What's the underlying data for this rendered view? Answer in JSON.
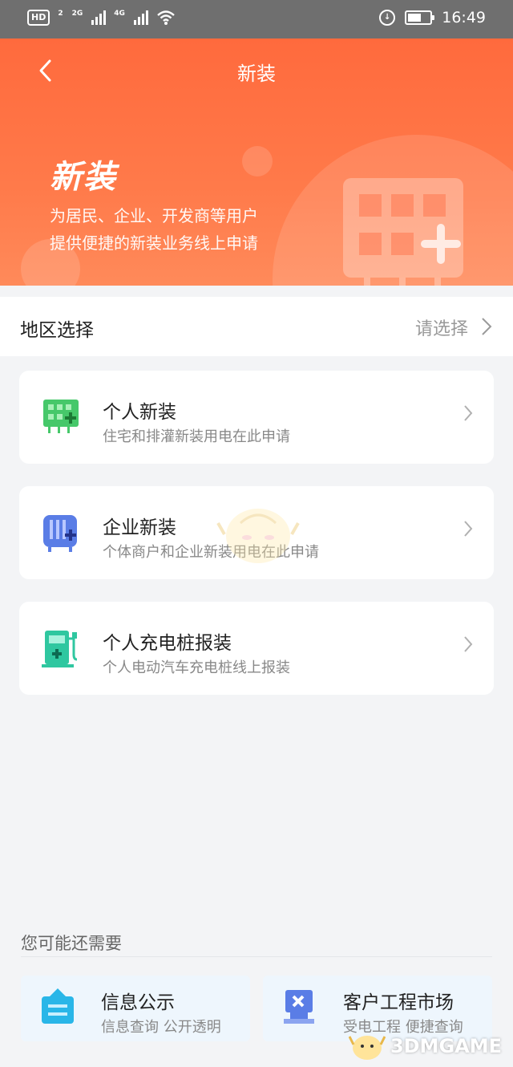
{
  "status_bar": {
    "hd_label": "HD",
    "sim_index": "2",
    "net_2g": "2G",
    "net_4g": "4G",
    "time": "16:49",
    "battery_percent": 60
  },
  "header": {
    "title": "新装"
  },
  "hero": {
    "heading": "新装",
    "desc_line1": "为居民、企业、开发商等用户",
    "desc_line2": "提供便捷的新装业务线上申请"
  },
  "region": {
    "label": "地区选择",
    "value": "请选择"
  },
  "services": [
    {
      "title": "个人新装",
      "subtitle": "住宅和排灌新装用电在此申请",
      "icon": "meter-icon"
    },
    {
      "title": "企业新装",
      "subtitle": "个体商户和企业新装用电在此申请",
      "icon": "building-icon"
    },
    {
      "title": "个人充电桩报装",
      "subtitle": "个人电动汽车充电桩线上报装",
      "icon": "charging-pile-icon"
    }
  ],
  "recommend": {
    "section_title": "您可能还需要",
    "items": [
      {
        "title": "信息公示",
        "subtitle": "信息查询 公开透明",
        "icon": "notice-board-icon"
      },
      {
        "title": "客户工程市场",
        "subtitle": "受电工程 便捷查询",
        "icon": "engineering-icon"
      }
    ]
  },
  "watermark": {
    "text": "3DMGAME"
  },
  "colors": {
    "brand": "#ff6a3d",
    "green": "#46c86a",
    "blue": "#5a7de6",
    "teal": "#2fc7a0",
    "cyan": "#29b6e8"
  }
}
